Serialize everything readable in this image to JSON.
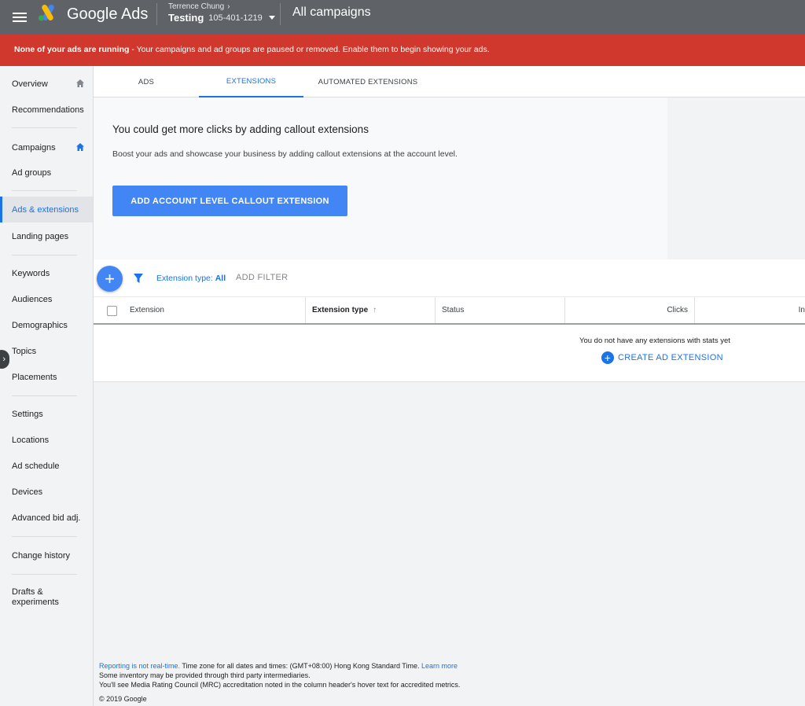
{
  "header": {
    "brand": "Google Ads",
    "account_manager": "Terrence Chung",
    "account_name": "Testing",
    "customer_id": "105-401-1219",
    "page_title": "All campaigns"
  },
  "alert": {
    "bold_text": "None of your ads are running",
    "text": " - Your campaigns and ad groups are paused or removed. Enable them to begin showing your ads."
  },
  "sidebar": {
    "items": [
      {
        "label": "Overview"
      },
      {
        "label": "Recommendations"
      },
      {
        "label": "Campaigns"
      },
      {
        "label": "Ad groups"
      },
      {
        "label": "Ads & extensions"
      },
      {
        "label": "Landing pages"
      },
      {
        "label": "Keywords"
      },
      {
        "label": "Audiences"
      },
      {
        "label": "Demographics"
      },
      {
        "label": "Topics"
      },
      {
        "label": "Placements"
      },
      {
        "label": "Settings"
      },
      {
        "label": "Locations"
      },
      {
        "label": "Ad schedule"
      },
      {
        "label": "Devices"
      },
      {
        "label": "Advanced bid adj."
      },
      {
        "label": "Change history"
      },
      {
        "label": "Drafts & experiments"
      }
    ],
    "active_item": "Ads & extensions"
  },
  "tabs": [
    {
      "label": "ADS"
    },
    {
      "label": "EXTENSIONS"
    },
    {
      "label": "AUTOMATED EXTENSIONS"
    }
  ],
  "active_tab": "EXTENSIONS",
  "promo": {
    "title": "You could get more clicks by adding callout extensions",
    "description": "Boost your ads and showcase your business by adding callout extensions at the account level.",
    "button_label": "ADD ACCOUNT LEVEL CALLOUT EXTENSION"
  },
  "filters": {
    "chip_label": "Extension type: ",
    "chip_value": "All",
    "add_filter_label": "ADD FILTER"
  },
  "table": {
    "columns": [
      {
        "label": "Extension"
      },
      {
        "label": "Extension type"
      },
      {
        "label": "Status"
      },
      {
        "label": "Clicks"
      },
      {
        "label": "In"
      }
    ],
    "sorted_column": "Extension type",
    "empty_message": "You do not have any extensions with stats yet",
    "create_label": "CREATE AD EXTENSION"
  },
  "footer": {
    "realtime_link": "Reporting is not real-time.",
    "timezone_text": " Time zone for all dates and times: (GMT+08:00) Hong Kong Standard Time. ",
    "learn_more": "Learn more",
    "line2": "Some inventory may be provided through third party intermediaries.",
    "line3": "You'll see Media Rating Council (MRC) accreditation noted in the column header's hover text for accredited metrics.",
    "copyright": "© 2019 Google"
  },
  "colors": {
    "topbar": "#5f6368",
    "alert": "#d0382e",
    "accent": "#4285f4",
    "link": "#1a73e8"
  }
}
